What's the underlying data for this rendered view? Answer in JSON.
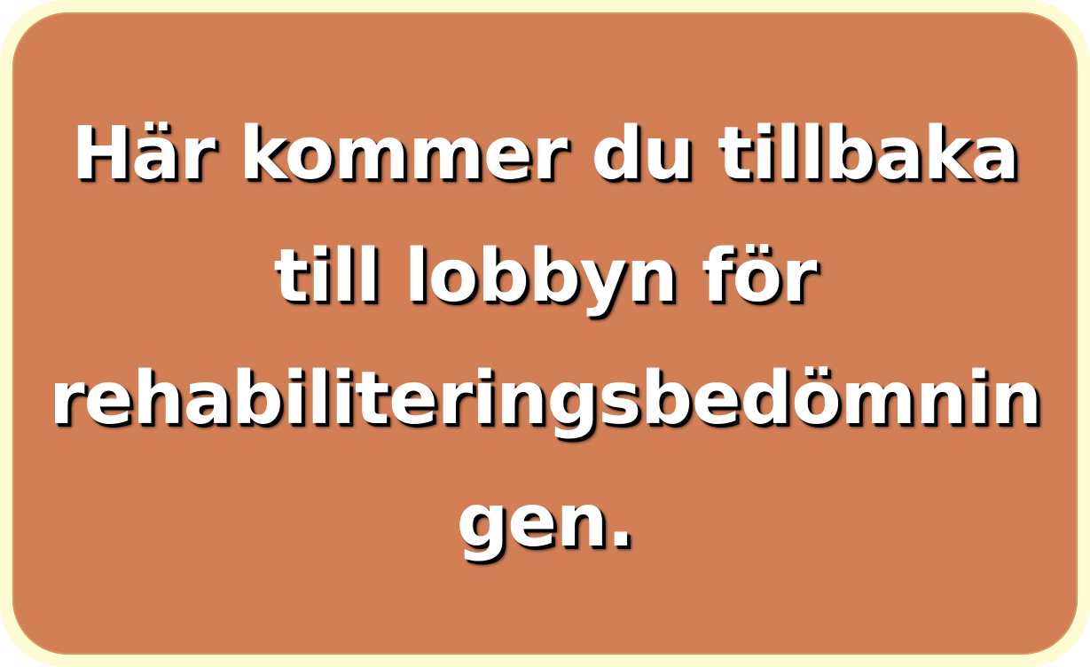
{
  "button": {
    "lines": [
      "Här kommer du tillbaka",
      "till lobbyn för",
      "rehabiliteringsbedömnin",
      "gen."
    ],
    "colors": {
      "background": "#d27f56",
      "border": "#fdfcd2",
      "text": "#ffffff",
      "text_shadow": "#000000"
    }
  }
}
